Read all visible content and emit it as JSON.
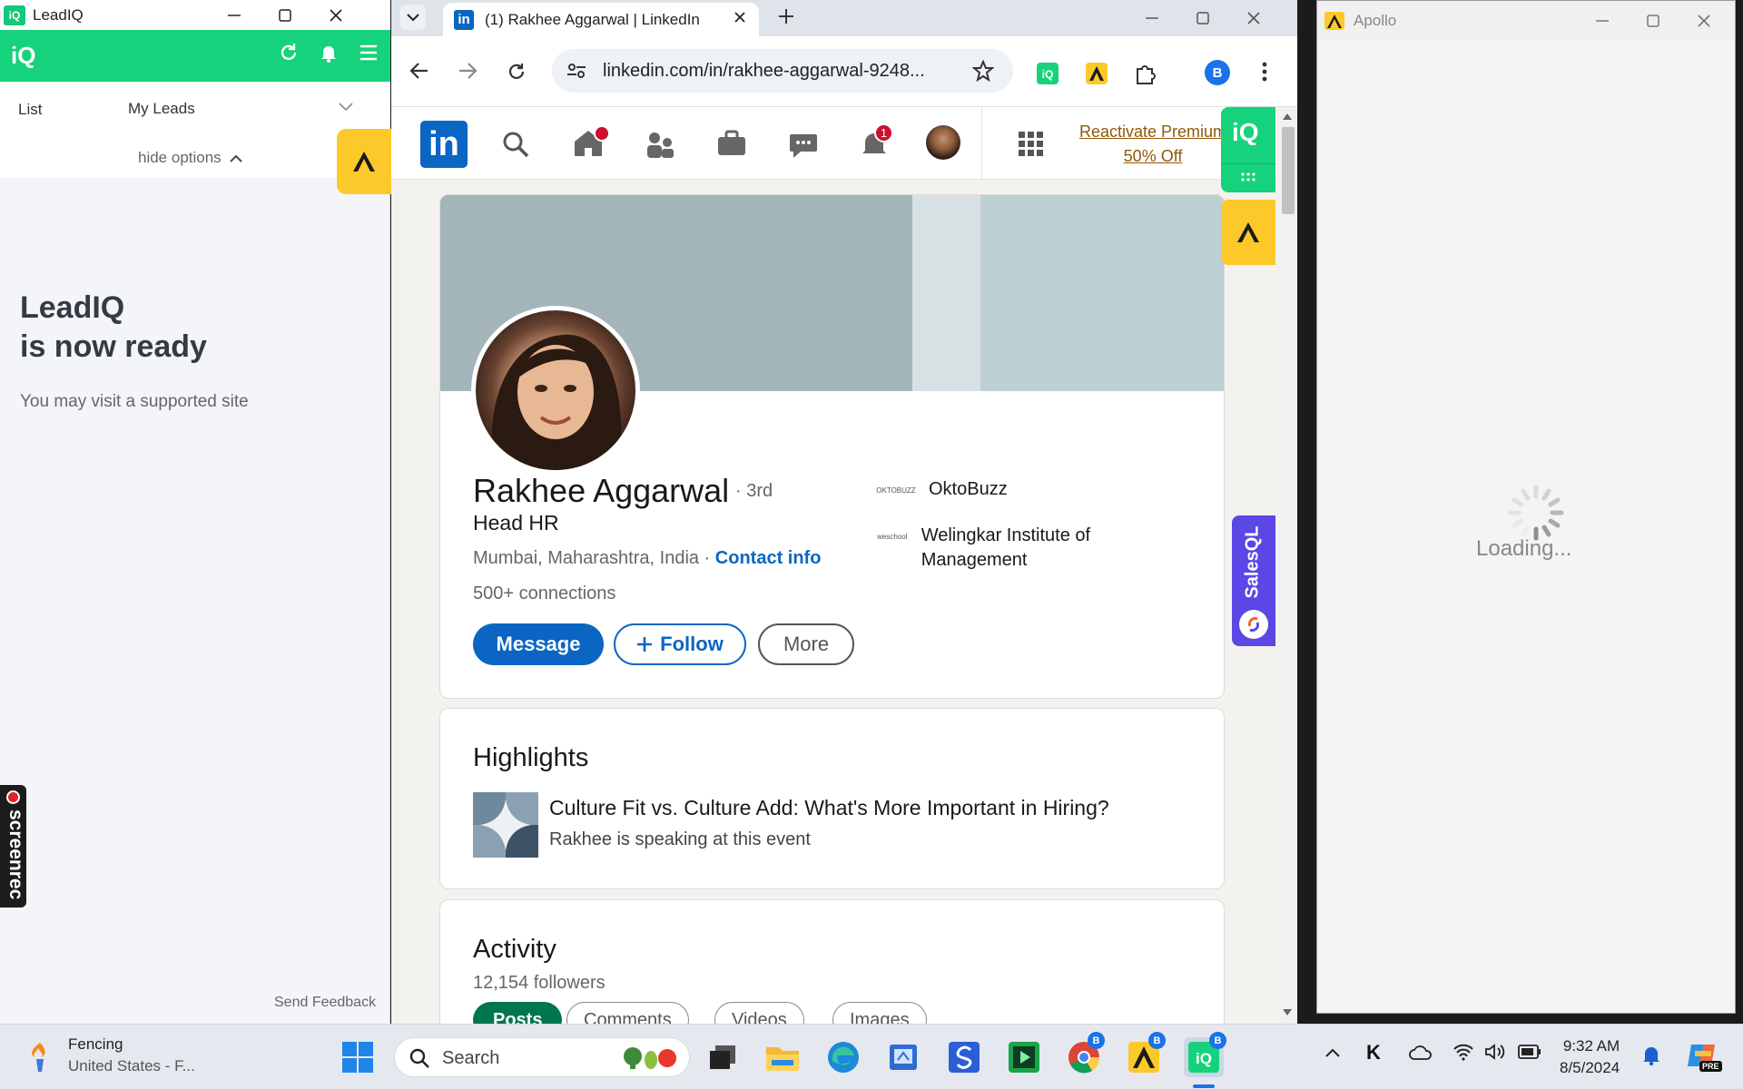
{
  "leadiq": {
    "window_title": "LeadIQ",
    "logo": "iQ",
    "list_label": "List",
    "list_value": "My Leads",
    "hide_options": "hide options",
    "ready_title_1": "LeadIQ",
    "ready_title_2": "is now ready",
    "visit_text": "You may visit a supported site",
    "feedback": "Send Feedback"
  },
  "screenrec": {
    "label": "screenrec"
  },
  "chrome": {
    "tab_title": "(1) Rakhee Aggarwal | LinkedIn",
    "url": "linkedin.com/in/rakhee-aggarwal-9248...",
    "profile_initial": "B"
  },
  "linkedin": {
    "logo": "in",
    "home_badge": "",
    "notif_badge": "1",
    "premium_line1": "Reactivate Premium",
    "premium_line2": "50% Off"
  },
  "profile": {
    "name": "Rakhee Aggarwal",
    "degree": "· 3rd",
    "headline": "Head HR",
    "location": "Mumbai, Maharashtra, India · ",
    "contact": "Contact info",
    "connections": "500+ connections",
    "message_btn": "Message",
    "follow_btn": "Follow",
    "more_btn": "More",
    "companies": [
      {
        "logo": "OKTOBUZZ",
        "name": "OktoBuzz"
      },
      {
        "logo": "weschool",
        "name": "Welingkar Institute of Management"
      }
    ]
  },
  "highlights": {
    "title": "Highlights",
    "item_title": "Culture Fit vs. Culture Add: What's More Important in Hiring?",
    "item_sub": "Rakhee is speaking at this event"
  },
  "activity": {
    "title": "Activity",
    "followers": "12,154 followers",
    "pills": [
      "Posts",
      "Comments",
      "Videos",
      "Images"
    ]
  },
  "salesql": {
    "label": "SalesQL"
  },
  "apollo": {
    "window_title": "Apollo",
    "loading": "Loading..."
  },
  "taskbar": {
    "weather_title": "Fencing",
    "weather_sub": "United States - F...",
    "search_placeholder": "Search",
    "time": "9:32 AM",
    "date": "8/5/2024",
    "chrome_badge": "B",
    "apollo_badge": "B",
    "leadiq_badge": "B",
    "k_label": "K",
    "copilot_label": "PRE"
  },
  "colors": {
    "leadiq_green": "#16d27c",
    "apollo_yellow": "#fcc92b",
    "linkedin_blue": "#0a66c2",
    "salesql_purple": "#5b46e6"
  }
}
